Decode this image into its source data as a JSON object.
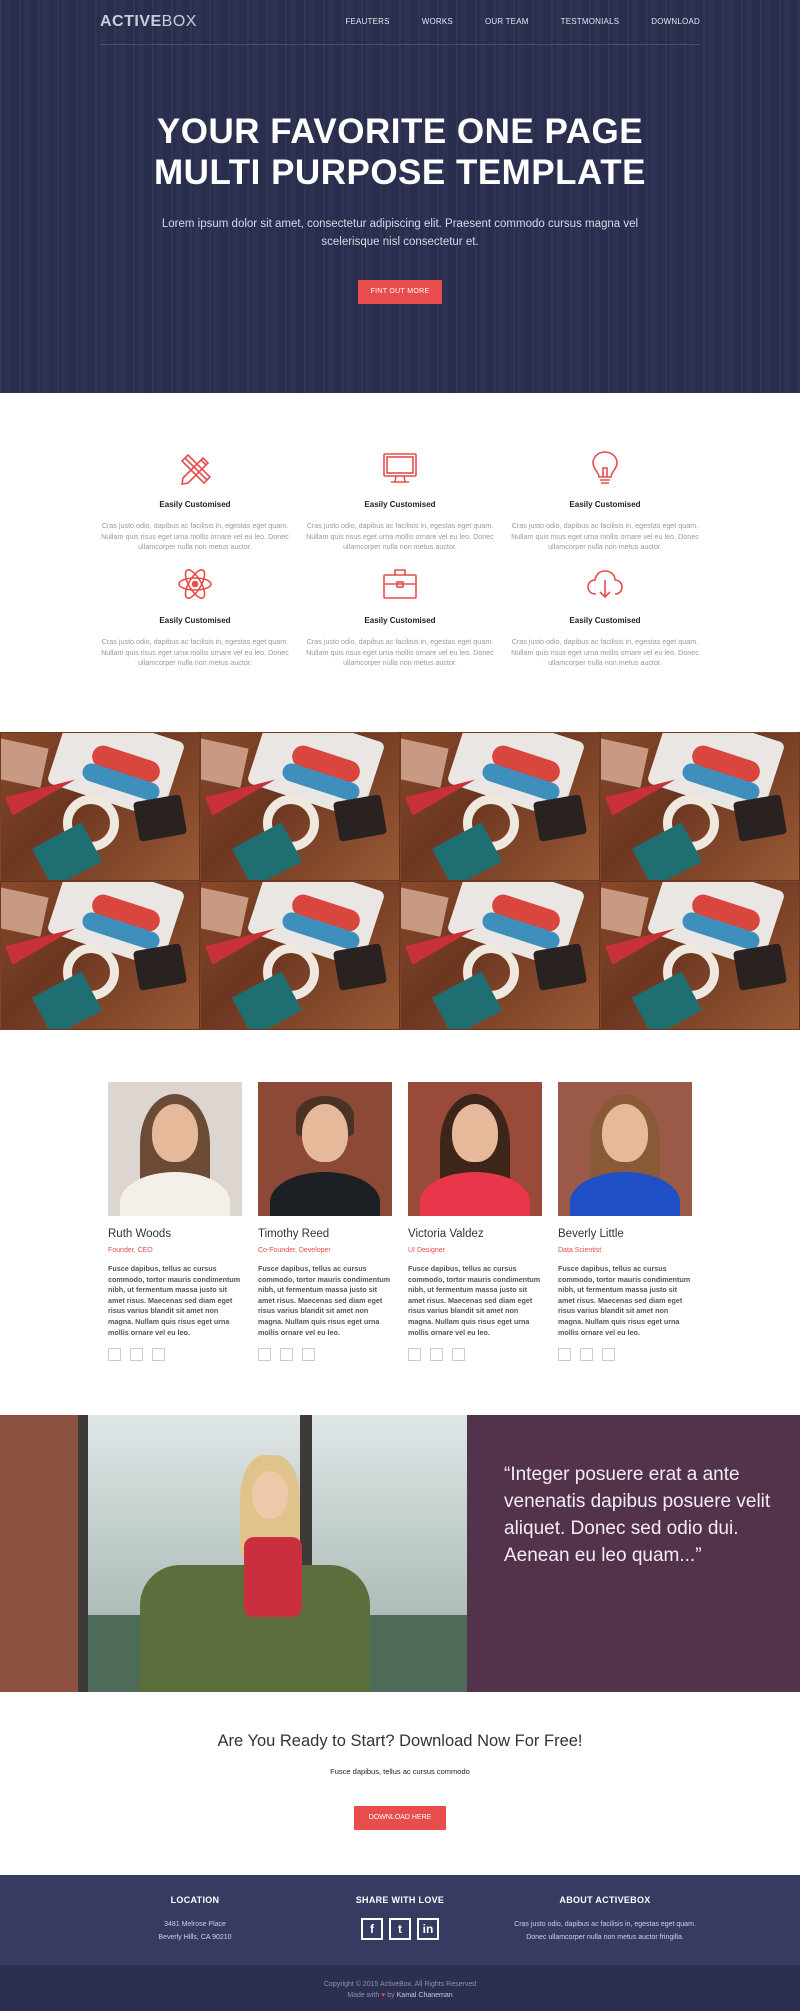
{
  "brand": {
    "bold": "ACTIVE",
    "light": "BOX"
  },
  "nav": [
    "FEAUTERS",
    "WORKS",
    "OUR TEAM",
    "TESTMONIALS",
    "DOWNLOAD"
  ],
  "hero": {
    "title_line1": "YOUR FAVORITE ONE PAGE",
    "title_line2": "MULTI PURPOSE TEMPLATE",
    "subtitle": "Lorem ipsum dolor sit amet, consectetur adipiscing elit. Praesent commodo cursus magna vel scelerisque nisl consectetur et.",
    "cta": "FINT OUT MORE"
  },
  "features": [
    {
      "icon": "pencil-ruler-icon",
      "title": "Easily Customised",
      "text": "Cras justo odio, dapibus ac facilisis in, egestas eget quam. Nullam quis risus eget urna mollis ornare vel eu leo. Donec ullamcorper nulla non metus auctor."
    },
    {
      "icon": "monitor-icon",
      "title": "Easily Customised",
      "text": "Cras justo odio, dapibus ac facilisis in, egestas eget quam. Nullam quis risus eget urna mollis ornare vel eu leo. Donec ullamcorper nulla non metus auctor."
    },
    {
      "icon": "lightbulb-icon",
      "title": "Easily Customised",
      "text": "Cras justo odio, dapibus ac facilisis in, egestas eget quam. Nullam quis risus eget urna mollis ornare vel eu leo. Donec ullamcorper nulla non metus auctor."
    },
    {
      "icon": "atom-icon",
      "title": "Easily Customised",
      "text": "Cras justo odio, dapibus ac facilisis in, egestas eget quam. Nullam quis risus eget urna mollis ornare vel eu leo. Donec ullamcorper nulla non metus auctor."
    },
    {
      "icon": "briefcase-icon",
      "title": "Easily Customised",
      "text": "Cras justo odio, dapibus ac facilisis in, egestas eget quam. Nullam quis risus eget urna mollis ornare vel eu leo. Donec ullamcorper nulla non metus auctor."
    },
    {
      "icon": "cloud-download-icon",
      "title": "Easily Customised",
      "text": "Cras justo odio, dapibus ac facilisis in, egestas eget quam. Nullam quis risus eget urna mollis ornare vel eu leo. Donec ullamcorper nulla non metus auctor."
    }
  ],
  "team": [
    {
      "name": "Ruth Woods",
      "role": "Founder, CEO",
      "bio": "Fusce dapibus, tellus ac cursus commodo, tortor mauris condimentum nibh, ut fermentum massa justo sit amet risus. Maecenas sed diam eget risus varius blandit sit amet non magna. Nullam quis risus eget urna mollis ornare vel eu leo."
    },
    {
      "name": "Timothy Reed",
      "role": "Co-Founder, Developer",
      "bio": "Fusce dapibus, tellus ac cursus commodo, tortor mauris condimentum nibh, ut fermentum massa justo sit amet risus. Maecenas sed diam eget risus varius blandit sit amet non magna. Nullam quis risus eget urna mollis ornare vel eu leo."
    },
    {
      "name": "Victoria Valdez",
      "role": "UI Designer",
      "bio": "Fusce dapibus, tellus ac cursus commodo, tortor mauris condimentum nibh, ut fermentum massa justo sit amet risus. Maecenas sed diam eget risus varius blandit sit amet non magna. Nullam quis risus eget urna mollis ornare vel eu leo."
    },
    {
      "name": "Beverly Little",
      "role": "Data Scientist",
      "bio": "Fusce dapibus, tellus ac cursus commodo, tortor mauris condimentum nibh, ut fermentum massa justo sit amet risus. Maecenas sed diam eget risus varius blandit sit amet non magna. Nullam quis risus eget urna mollis ornare vel eu leo."
    }
  ],
  "testimonial": {
    "quote": "“Integer posuere erat a ante venenatis dapibus posuere velit aliquet. Donec sed odio dui. Aenean eu leo quam...”"
  },
  "download": {
    "title": "Are You Ready to Start? Download Now For Free!",
    "subtitle": "Fusce dapibus, tellus ac cursus commodo",
    "button": "DOWNLOAD HERE"
  },
  "footer": {
    "location_title": "LOCATION",
    "address_line1": "3481 Melrose Place",
    "address_line2": "Beverly Hills, CA 90210",
    "share_title": "SHARE WITH LOVE",
    "about_title": "ABOUT ACTIVEBOX",
    "about_text": "Cras justo odio, dapibus ac facilisis in, egestas eget quam. Donec ullamcorper nulla non metus auctor fringilla.",
    "copyright": "Copyright © 2015 ActiveBox. All Rights Reserved",
    "made_with": "Made with",
    "by": "by",
    "author": "Kamal Chaneman"
  },
  "colors": {
    "accent": "#e84c4c",
    "hero_bg": "#2b3050",
    "quote_bg": "#52334b",
    "footer_bg": "#383b61",
    "footer_bottom": "#2c2f4f"
  }
}
